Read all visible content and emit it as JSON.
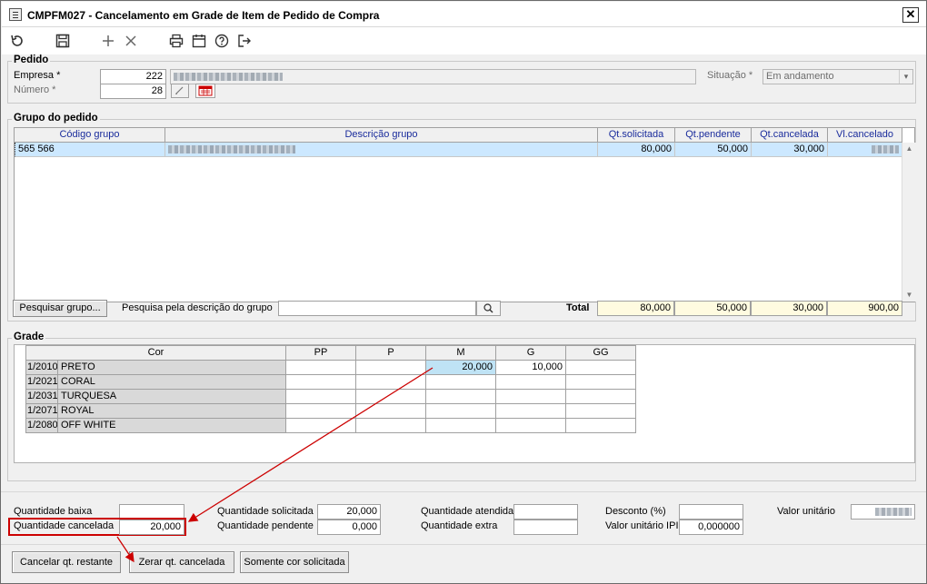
{
  "window": {
    "title": "CMPFM027 - Cancelamento em Grade de Item de Pedido de Compra",
    "close": "✕"
  },
  "pedido": {
    "legend": "Pedido",
    "empresa_label": "Empresa *",
    "empresa_value": "222",
    "numero_label": "Número *",
    "numero_value": "28",
    "situacao_label": "Situação *",
    "situacao_value": "Em andamento"
  },
  "grupo": {
    "legend": "Grupo do pedido",
    "columns": [
      "Código grupo",
      "Descrição grupo",
      "Qt.solicitada",
      "Qt.pendente",
      "Qt.cancelada",
      "Vl.cancelado"
    ],
    "rows": [
      {
        "codigo": "565 566",
        "qt_solicitada": "80,000",
        "qt_pendente": "50,000",
        "qt_cancelada": "30,000"
      }
    ],
    "pesquisar_button": "Pesquisar grupo...",
    "pesquisa_label": "Pesquisa pela descrição do grupo",
    "total_label": "Total",
    "totals": {
      "qt_solicitada": "80,000",
      "qt_pendente": "50,000",
      "qt_cancelada": "30,000",
      "vl_cancelado": "900,00"
    }
  },
  "grade": {
    "legend": "Grade",
    "columns": [
      "Cor",
      "PP",
      "P",
      "M",
      "G",
      "GG"
    ],
    "rows": [
      {
        "code": "1/2010",
        "cor": "PRETO",
        "M": "20,000",
        "G": "10,000"
      },
      {
        "code": "1/2021",
        "cor": "CORAL"
      },
      {
        "code": "1/2031",
        "cor": "TURQUESA"
      },
      {
        "code": "1/2071",
        "cor": "ROYAL"
      },
      {
        "code": "1/2080",
        "cor": "OFF WHITE"
      }
    ]
  },
  "summary": {
    "quantidade_baixa_label": "Quantidade baixa",
    "quantidade_baixa_value": "",
    "quantidade_cancelada_label": "Quantidade cancelada",
    "quantidade_cancelada_value": "20,000",
    "quantidade_solicitada_label": "Quantidade solicitada",
    "quantidade_solicitada_value": "20,000",
    "quantidade_pendente_label": "Quantidade pendente",
    "quantidade_pendente_value": "0,000",
    "quantidade_atendida_label": "Quantidade atendida",
    "quantidade_atendida_value": "",
    "quantidade_extra_label": "Quantidade extra",
    "quantidade_extra_value": "",
    "desconto_label": "Desconto (%)",
    "desconto_value": "",
    "valor_unitario_ipi_label": "Valor unitário IPI",
    "valor_unitario_ipi_value": "0,000000",
    "valor_unitario_label": "Valor unitário"
  },
  "buttons": {
    "cancelar_restante": "Cancelar qt. restante",
    "zerar": "Zerar qt. cancelada",
    "somente_cor": "Somente cor solicitada"
  },
  "colors": {
    "selected_row": "#cce8ff",
    "highlight_cell": "#bfe3f5",
    "totals_bg": "#fffbe0",
    "annotation": "#cc0000"
  }
}
